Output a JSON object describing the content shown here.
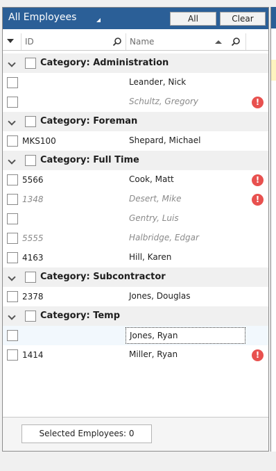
{
  "panel": {
    "title": "All Employees",
    "all_label": "All",
    "clear_label": "Clear"
  },
  "columns": {
    "id": "ID",
    "name": "Name"
  },
  "rows": [
    {
      "type": "category",
      "label": "Category: Administration"
    },
    {
      "type": "employee",
      "id": "",
      "name": "Leander, Nick",
      "inactive": false,
      "warning": false
    },
    {
      "type": "employee",
      "id": "",
      "name": "Schultz, Gregory",
      "inactive": true,
      "warning": true
    },
    {
      "type": "category",
      "label": "Category: Foreman"
    },
    {
      "type": "employee",
      "id": "MKS100",
      "name": "Shepard, Michael",
      "inactive": false,
      "warning": false
    },
    {
      "type": "category",
      "label": "Category: Full Time"
    },
    {
      "type": "employee",
      "id": "5566",
      "name": "Cook, Matt",
      "inactive": false,
      "warning": true
    },
    {
      "type": "employee",
      "id": "1348",
      "name": "Desert, Mike",
      "inactive": true,
      "warning": true
    },
    {
      "type": "employee",
      "id": "",
      "name": "Gentry, Luis",
      "inactive": true,
      "warning": false
    },
    {
      "type": "employee",
      "id": "5555",
      "name": "Halbridge, Edgar",
      "inactive": true,
      "warning": false
    },
    {
      "type": "employee",
      "id": "4163",
      "name": "Hill, Karen",
      "inactive": false,
      "warning": false
    },
    {
      "type": "category",
      "label": "Category: Subcontractor"
    },
    {
      "type": "employee",
      "id": "2378",
      "name": "Jones, Douglas",
      "inactive": false,
      "warning": false
    },
    {
      "type": "category",
      "label": "Category: Temp"
    },
    {
      "type": "employee",
      "id": "",
      "name": "Jones, Ryan",
      "inactive": false,
      "warning": false,
      "selected": true
    },
    {
      "type": "employee",
      "id": "1414",
      "name": "Miller, Ryan",
      "inactive": false,
      "warning": true
    }
  ],
  "footer": {
    "selected_text": "Selected Employees: 0"
  },
  "colors": {
    "title_bar": "#2b5f97",
    "warning": "#e8514f",
    "inactive_text": "#8a8a8a"
  },
  "icons": {
    "warning": "exclamation-circle-icon",
    "search": "search-icon",
    "expand": "chevron-down-icon"
  }
}
